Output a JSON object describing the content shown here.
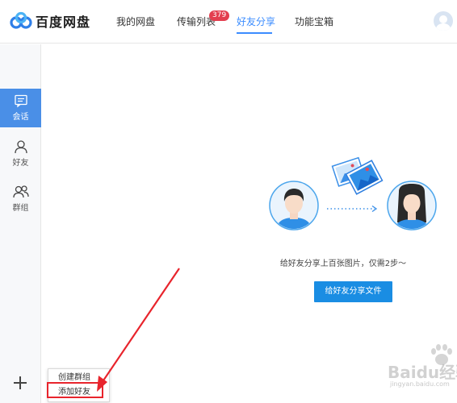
{
  "app": {
    "logo_text": "百度网盘",
    "brand_color": "#3b8cff"
  },
  "header": {
    "nav": [
      {
        "label": "我的网盘"
      },
      {
        "label": "传输列表",
        "badge": "379"
      },
      {
        "label": "好友分享",
        "active": true
      },
      {
        "label": "功能宝箱"
      }
    ]
  },
  "sidebar": {
    "items": [
      {
        "label": "会话",
        "icon": "chat-icon",
        "active": true
      },
      {
        "label": "好友",
        "icon": "person-icon"
      },
      {
        "label": "群组",
        "icon": "group-icon"
      }
    ],
    "add_icon": "plus-icon"
  },
  "popup_menu": {
    "items": [
      {
        "label": "创建群组"
      },
      {
        "label": "添加好友",
        "highlighted": true
      }
    ]
  },
  "main": {
    "tip": "给好友分享上百张图片，仅需2步～",
    "share_button": "给好友分享文件"
  },
  "watermark": {
    "text": "Baidu经验",
    "sub": "jingyan.baidu.com"
  },
  "colors": {
    "active_sidebar": "#4a8fe7",
    "button": "#1a8de3",
    "badge": "#e33e4f",
    "annotation": "#e8242c"
  }
}
